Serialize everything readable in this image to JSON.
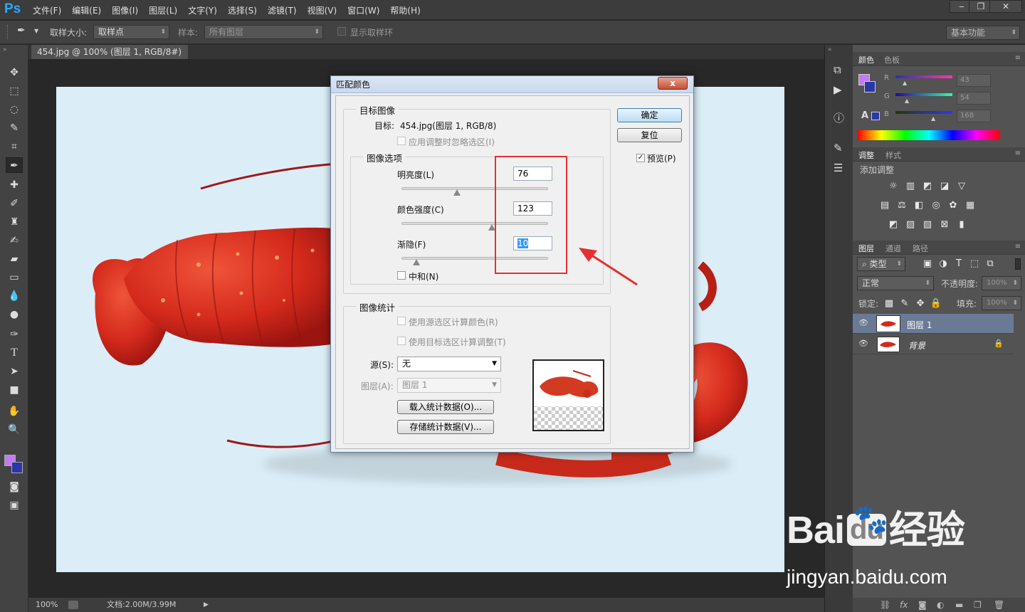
{
  "app": {
    "logo": "Ps"
  },
  "menu": [
    "文件(F)",
    "编辑(E)",
    "图像(I)",
    "图层(L)",
    "文字(Y)",
    "选择(S)",
    "滤镜(T)",
    "视图(V)",
    "窗口(W)",
    "帮助(H)"
  ],
  "options": {
    "sample_size_label": "取样大小:",
    "sample_size_value": "取样点",
    "sample_label": "样本:",
    "sample_value": "所有图层",
    "show_ring_label": "显示取样环",
    "workspace": "基本功能"
  },
  "doc": {
    "tab_title": "454.jpg @ 100% (图层 1, RGB/8#) *",
    "tab_close": "×"
  },
  "status": {
    "zoom": "100%",
    "doc_size": "文档:2.00M/3.99M"
  },
  "color_panel": {
    "tabs": [
      "颜色",
      "色板"
    ],
    "r_label": "R",
    "g_label": "G",
    "b_label": "B",
    "r": "43",
    "g": "54",
    "b": "168",
    "fg_color": "#c37bf0",
    "bg_color": "#2b36a8"
  },
  "adjust_panel": {
    "tabs": [
      "调整",
      "样式"
    ],
    "title": "添加调整"
  },
  "layers_panel": {
    "tabs": [
      "图层",
      "通道",
      "路径"
    ],
    "kind_label": "类型",
    "blend_mode": "正常",
    "opacity_label": "不透明度:",
    "opacity_value": "100%",
    "lock_label": "锁定:",
    "fill_label": "填充:",
    "fill_value": "100%",
    "layers": [
      {
        "name": "图层 1",
        "selected": true
      },
      {
        "name": "背景",
        "selected": false
      }
    ]
  },
  "dialog": {
    "title": "匹配颜色",
    "close": "x",
    "ok": "确定",
    "reset": "复位",
    "preview_label": "预览(P)",
    "target_group": "目标图像",
    "target_label": "目标:",
    "target_value": "454.jpg(图层 1, RGB/8)",
    "ignore_selection": "应用调整时忽略选区(I)",
    "image_options_group": "图像选项",
    "luminance_label": "明亮度(L)",
    "luminance_value": "76",
    "luminance": 0.38,
    "intensity_label": "颜色强度(C)",
    "intensity_value": "123",
    "intensity": 0.615,
    "fade_label": "渐隐(F)",
    "fade_value": "10",
    "fade": 0.1,
    "neutralize_label": "中和(N)",
    "stats_group": "图像统计",
    "use_source_sel": "使用源选区计算颜色(R)",
    "use_target_sel": "使用目标选区计算调整(T)",
    "source_label": "源(S):",
    "source_value": "无",
    "layer_label": "图层(A):",
    "layer_value": "图层 1",
    "load_stats": "载入统计数据(O)...",
    "save_stats": "存储统计数据(V)..."
  },
  "watermark": {
    "brand_a": "Bai",
    "brand_b": "du",
    "brand_c": "经验",
    "url": "jingyan.baidu.com"
  }
}
